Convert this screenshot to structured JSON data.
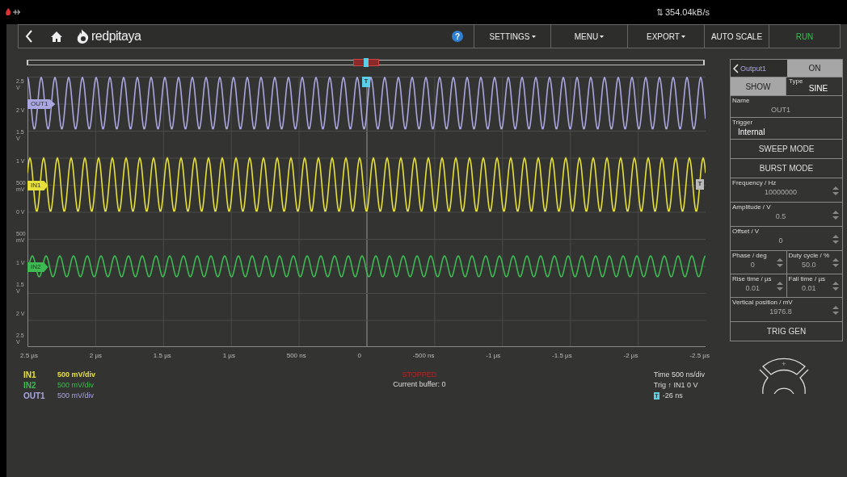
{
  "status_bar": {
    "data_rate": "354.04kB/s"
  },
  "nav": {
    "logo": "redpitaya",
    "help": "?",
    "items": [
      {
        "kind": "menu",
        "label": "SETTINGS"
      },
      {
        "kind": "menu",
        "label": "MENU"
      },
      {
        "kind": "menu",
        "label": "EXPORT"
      },
      {
        "kind": "button",
        "label": "AUTO SCALE"
      },
      {
        "kind": "run",
        "label": "RUN"
      }
    ]
  },
  "buffer_slider": {
    "level": 0.5
  },
  "plot": {
    "y_labels": [
      "2.5 V",
      "2 V",
      "1.5 V",
      "1 V",
      "500 mV",
      "0 V",
      "500 mV",
      "1 V",
      "1.5 V",
      "2 V",
      "2.5 V"
    ],
    "x_labels": [
      "2.5 µs",
      "2 µs",
      "1.5 µs",
      "1 µs",
      "500 ns",
      "0",
      "-500 ns",
      "-1 µs",
      "-1.5 µs",
      "-2 µs",
      "-2.5 µs"
    ],
    "traces": [
      {
        "name": "OUT1",
        "color": "#a9a6e0"
      },
      {
        "name": "IN1",
        "color": "#e6e03a"
      },
      {
        "name": "IN2",
        "color": "#3dbb52"
      }
    ],
    "trigger_marker": "T",
    "level_marker": "T"
  },
  "legend": [
    {
      "name": "IN1",
      "scale": "500 mV/div",
      "color": "#e6e03a"
    },
    {
      "name": "IN2",
      "scale": "500 mV/div",
      "color": "#3dbb52"
    },
    {
      "name": "OUT1",
      "scale": "500 mV/div",
      "color": "#a9a6e0"
    }
  ],
  "acquisition": {
    "state": "STOPPED",
    "buffer": "Current buffer: 0"
  },
  "timing": {
    "time": "Time 500 ns/div",
    "trigger": "Trig ↑ IN1 0 V",
    "marker": "T",
    "offset": "-26 ns"
  },
  "panel": {
    "output": "Output1",
    "on": {
      "label": "ON",
      "active": true
    },
    "show": {
      "label": "SHOW",
      "active": true
    },
    "type_label": "Type",
    "type": "SINE",
    "rows": [
      {
        "kind": "name",
        "label": "Name",
        "value": "OUT1"
      },
      {
        "kind": "select",
        "label": "Trigger",
        "value": "Internal"
      },
      {
        "kind": "button",
        "value": "SWEEP MODE"
      },
      {
        "kind": "button",
        "value": "BURST MODE"
      },
      {
        "kind": "spin",
        "label": "Frequency / Hz",
        "value": "10000000"
      },
      {
        "kind": "spin",
        "label": "Amplitude / V",
        "value": "0.5"
      },
      {
        "kind": "spin",
        "label": "Offset / V",
        "value": "0"
      },
      {
        "kind": "pair",
        "items": [
          {
            "label": "Phase / deg",
            "value": "0"
          },
          {
            "label": "Duty cycle / %",
            "value": "50.0"
          }
        ]
      },
      {
        "kind": "pair",
        "items": [
          {
            "label": "Rise time / µs",
            "value": "0.01"
          },
          {
            "label": "Fall time / µs",
            "value": "0.01"
          }
        ]
      },
      {
        "kind": "spin",
        "label": "Vertical position / mV",
        "value": "1976.8"
      },
      {
        "kind": "button",
        "value": "TRIG GEN"
      }
    ],
    "joystick": "+"
  }
}
